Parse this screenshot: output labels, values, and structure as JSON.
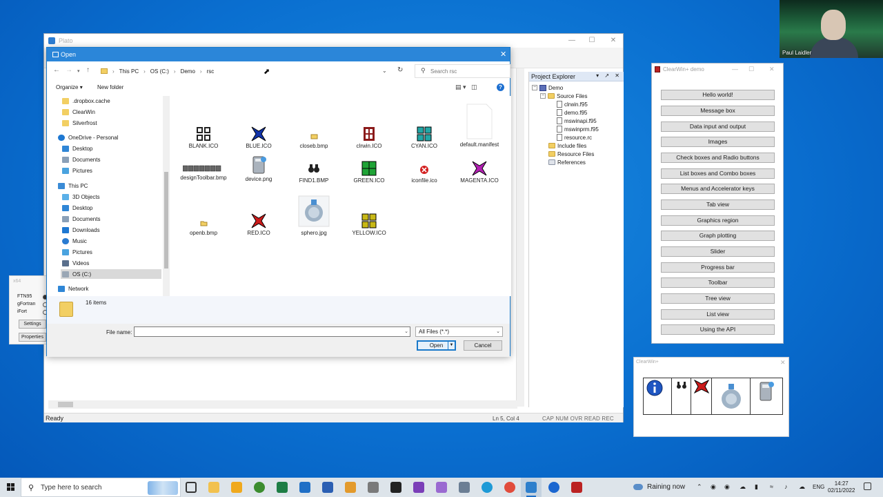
{
  "plato": {
    "title": "Plato",
    "status_ready": "Ready",
    "status_position": "Ln 5, Col 4",
    "status_keys": "CAP  NUM  OVR  READ  REC"
  },
  "project_explorer": {
    "title": "Project Explorer",
    "items": [
      {
        "label": "Demo",
        "icon": "project-icon"
      },
      {
        "label": "Source Files",
        "icon": "folder-icon"
      },
      {
        "label": "clrwin.f95",
        "icon": "file-icon"
      },
      {
        "label": "demo.f95",
        "icon": "file-icon"
      },
      {
        "label": "mswinapi.f95",
        "icon": "file-icon"
      },
      {
        "label": "mswinprm.f95",
        "icon": "file-icon"
      },
      {
        "label": "resource.rc",
        "icon": "file-icon"
      },
      {
        "label": "Include files",
        "icon": "folder-icon"
      },
      {
        "label": "Resource Files",
        "icon": "folder-icon"
      },
      {
        "label": "References",
        "icon": "references-icon"
      }
    ]
  },
  "compilers": {
    "platform": "x64",
    "options": [
      "FTN95",
      "gFortran",
      "iFort"
    ],
    "settings_label": "Settings",
    "properties_label": "Properties"
  },
  "open_dialog": {
    "title": "Open",
    "breadcrumb": [
      "This PC",
      "OS (C:)",
      "Demo",
      "rsc"
    ],
    "search_placeholder": "Search rsc",
    "organize_label": "Organize",
    "new_folder_label": "New folder",
    "nav_items": [
      {
        "label": ".dropbox.cache",
        "icon": "folder-icon"
      },
      {
        "label": "ClearWin",
        "icon": "folder-icon"
      },
      {
        "label": "Silverfrost",
        "icon": "folder-icon"
      },
      {
        "label": "OneDrive - Personal",
        "icon": "cloud-icon"
      },
      {
        "label": "Desktop",
        "icon": "desktop-icon"
      },
      {
        "label": "Documents",
        "icon": "documents-icon"
      },
      {
        "label": "Pictures",
        "icon": "pictures-icon"
      },
      {
        "label": "This PC",
        "icon": "computer-icon"
      },
      {
        "label": "3D Objects",
        "icon": "3d-objects-icon"
      },
      {
        "label": "Desktop",
        "icon": "desktop-icon"
      },
      {
        "label": "Documents",
        "icon": "documents-icon"
      },
      {
        "label": "Downloads",
        "icon": "downloads-icon"
      },
      {
        "label": "Music",
        "icon": "music-icon"
      },
      {
        "label": "Pictures",
        "icon": "pictures-icon"
      },
      {
        "label": "Videos",
        "icon": "videos-icon"
      },
      {
        "label": "OS (C:)",
        "icon": "drive-icon"
      },
      {
        "label": "Network",
        "icon": "network-icon"
      }
    ],
    "files": [
      {
        "name": "BLANK.ICO",
        "icon": "blank-icon"
      },
      {
        "name": "BLUE.ICO",
        "icon": "blue-icon"
      },
      {
        "name": "closeb.bmp",
        "icon": "closed-folder-bitmap-icon"
      },
      {
        "name": "clrwin.ICO",
        "icon": "clrwin-icon"
      },
      {
        "name": "CYAN.ICO",
        "icon": "cyan-icon"
      },
      {
        "name": "default.manifest",
        "icon": "document-icon"
      },
      {
        "name": "designToolbar.bmp",
        "icon": "toolbar-bitmap-icon"
      },
      {
        "name": "device.png",
        "icon": "device-icon"
      },
      {
        "name": "FIND1.BMP",
        "icon": "binoculars-icon"
      },
      {
        "name": "GREEN.ICO",
        "icon": "green-icon"
      },
      {
        "name": "iconfile.ico",
        "icon": "error-icon"
      },
      {
        "name": "MAGENTA.ICO",
        "icon": "magenta-icon"
      },
      {
        "name": "openb.bmp",
        "icon": "open-folder-bitmap-icon"
      },
      {
        "name": "RED.ICO",
        "icon": "red-icon"
      },
      {
        "name": "sphero.jpg",
        "icon": "sphero-icon"
      },
      {
        "name": "YELLOW.ICO",
        "icon": "yellow-icon"
      }
    ],
    "item_count": "16 items",
    "file_name_label": "File name:",
    "file_name_value": "",
    "file_type": "All Files (*.*)",
    "open_label": "Open",
    "cancel_label": "Cancel"
  },
  "clearwin_demo": {
    "title": "ClearWin+ demo",
    "buttons": [
      "Hello world!",
      "Message box",
      "Data input and output",
      "Images",
      "Check boxes and Radio buttons",
      "List boxes and Combo boxes",
      "Menus and Accelerator keys",
      "Tab view",
      "Graphics region",
      "Graph plotting",
      "Slider",
      "Progress bar",
      "Toolbar",
      "Tree view",
      "List view",
      "Using the API"
    ]
  },
  "clearwin_icons": {
    "title": "ClearWin+",
    "icons": [
      "info-icon",
      "binoculars-icon",
      "red-icon",
      "sphero-icon",
      "device-icon"
    ]
  },
  "webcam": {
    "name": "Paul Laidler"
  },
  "taskbar": {
    "search_placeholder": "Type here to search",
    "weather": "Raining now",
    "language": "ENG",
    "time": "14:27",
    "date": "02/11/2022"
  },
  "colors": {
    "desktop": "#0a6fd0",
    "dialog_title": "#2b86d9",
    "accent": "#1979ca"
  }
}
